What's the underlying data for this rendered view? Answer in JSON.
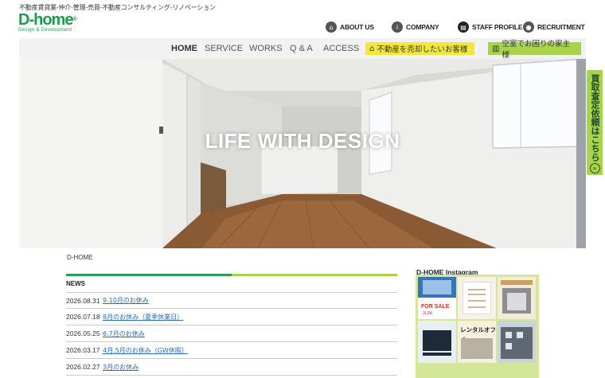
{
  "header": {
    "tagline": "不動産賃貸業-仲介-管理-売買-不動産コンサルティング-リノベーション",
    "logo_text": "D-home",
    "logo_reg": "®",
    "logo_sub": "Design & Development"
  },
  "top_links": [
    {
      "label": "ABOUT US",
      "icon": "home-icon"
    },
    {
      "label": "COMPANY",
      "icon": "info-icon"
    },
    {
      "label": "STAFF PROFILE",
      "icon": "staff-icon"
    },
    {
      "label": "RECRUITMENT",
      "icon": "person-icon"
    }
  ],
  "nav": {
    "items": [
      "HOME",
      "SERVICE",
      "WORKS",
      "Q & A",
      "ACCESS"
    ],
    "active": "HOME",
    "sell_button": "不動産を売却したいお客様",
    "vacancy_button": "空室でお困りの家主様"
  },
  "hero": {
    "title": "LIFE WITH DESIGN"
  },
  "side_tab": {
    "label": "買取査定依頼はこちら",
    "arrow": "»"
  },
  "breadcrumb": "D-HOME",
  "news": {
    "heading": "NEWS",
    "items": [
      {
        "date": "2026.08.31",
        "title": "9.10月のお休み"
      },
      {
        "date": "2026.07.18",
        "title": "8月のお休み（夏季休業日）"
      },
      {
        "date": "2026.05.25",
        "title": "6.7月のお休み"
      },
      {
        "date": "2026.03.17",
        "title": "4月.5月のお休み（GW休暇）"
      },
      {
        "date": "2026.02.27",
        "title": "3月のお休み"
      }
    ]
  },
  "instagram": {
    "heading": "D-HOME Instagram",
    "tile1_text": "FOR SALE",
    "tile1_sub": "3LDK",
    "tile5_text": "レンタルオフィ"
  },
  "colors": {
    "brand_green": "#1f9a4a",
    "accent_yellow": "#f2e83c",
    "accent_lime": "#a9d34a",
    "link_blue": "#2a6db5"
  }
}
